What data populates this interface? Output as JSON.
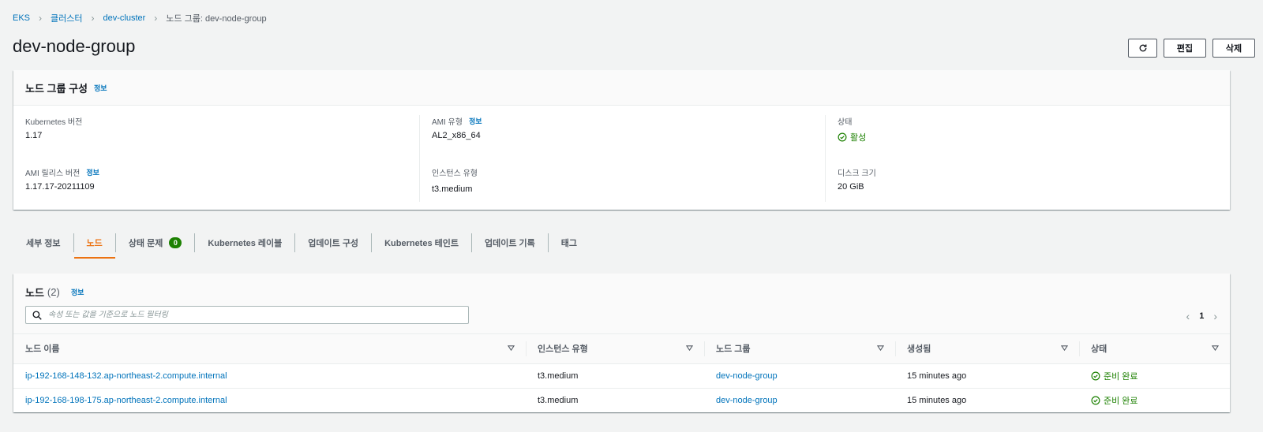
{
  "breadcrumb": {
    "items": [
      "EKS",
      "클러스터",
      "dev-cluster"
    ],
    "current": "노드 그룹: dev-node-group"
  },
  "page": {
    "title": "dev-node-group",
    "edit_label": "편집",
    "delete_label": "삭제"
  },
  "config": {
    "title": "노드 그룹 구성",
    "info": "정보",
    "fields": {
      "k8s_version_label": "Kubernetes 버전",
      "k8s_version_value": "1.17",
      "ami_type_label": "AMI 유형",
      "ami_type_value": "AL2_x86_64",
      "status_label": "상태",
      "status_value": "활성",
      "ami_release_label": "AMI 릴리스 버전",
      "ami_release_value": "1.17.17-20211109",
      "instance_type_label": "인스턴스 유형",
      "instance_type_value": "t3.medium",
      "disk_size_label": "디스크 크기",
      "disk_size_value": "20 GiB"
    }
  },
  "tabs": [
    {
      "label": "세부 정보"
    },
    {
      "label": "노드",
      "active": true
    },
    {
      "label": "상태 문제",
      "badge": "0"
    },
    {
      "label": "Kubernetes 레이블"
    },
    {
      "label": "업데이트 구성"
    },
    {
      "label": "Kubernetes 테인트"
    },
    {
      "label": "업데이트 기록"
    },
    {
      "label": "태그"
    }
  ],
  "nodes": {
    "title": "노드",
    "count": "(2)",
    "info": "정보",
    "search_placeholder": "속성 또는 값을 기준으로 노드 필터링",
    "page": "1",
    "columns": [
      "노드 이름",
      "인스턴스 유형",
      "노드 그룹",
      "생성됨",
      "상태"
    ],
    "rows": [
      {
        "name": "ip-192-168-148-132.ap-northeast-2.compute.internal",
        "instance_type": "t3.medium",
        "node_group": "dev-node-group",
        "created": "15 minutes ago",
        "status": "준비 완료"
      },
      {
        "name": "ip-192-168-198-175.ap-northeast-2.compute.internal",
        "instance_type": "t3.medium",
        "node_group": "dev-node-group",
        "created": "15 minutes ago",
        "status": "준비 완료"
      }
    ]
  },
  "colors": {
    "link": "#0073bb",
    "accent": "#ec7211",
    "success": "#1d8102"
  }
}
